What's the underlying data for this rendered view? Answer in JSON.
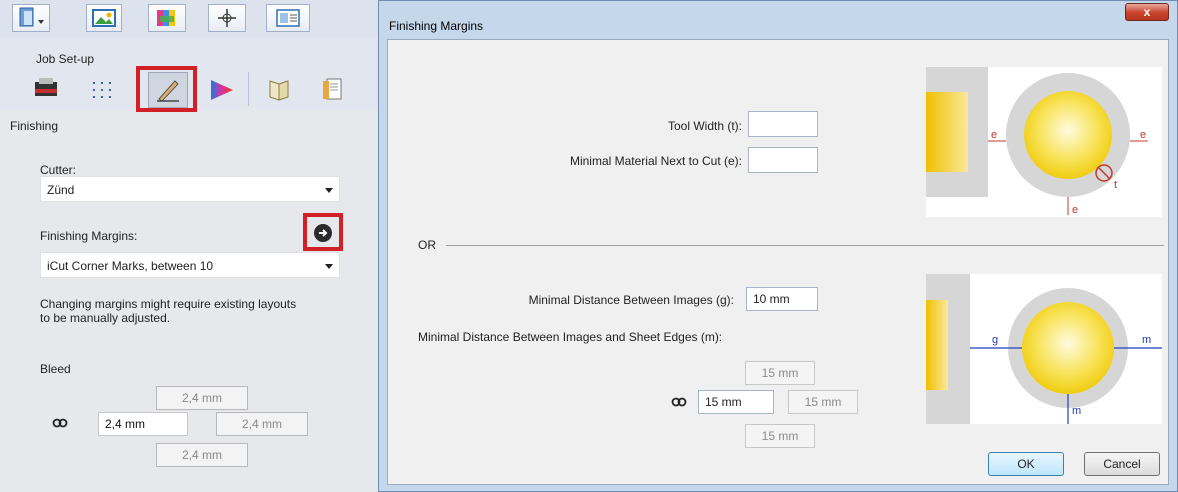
{
  "left_panel": {
    "section_title": "Job Set-up",
    "finishing_heading": "Finishing",
    "cutter_label": "Cutter:",
    "cutter_value": "Zünd",
    "finishing_margins_label": "Finishing Margins:",
    "finishing_margins_value": "iCut Corner Marks, between 10",
    "warning_text_line1": "Changing margins might require existing layouts",
    "warning_text_line2": "to be manually adjusted.",
    "bleed_label": "Bleed",
    "bleed_top": "2,4 mm",
    "bleed_left": "2,4 mm",
    "bleed_right": "2,4 mm",
    "bleed_bottom": "2,4 mm"
  },
  "dialog": {
    "title": "Finishing Margins",
    "close_label": "x",
    "tool_width_label": "Tool Width (t):",
    "tool_width_value": "",
    "min_material_label": "Minimal Material Next to Cut (e):",
    "min_material_value": "",
    "or_label": "OR",
    "min_distance_images_label": "Minimal Distance Between Images (g):",
    "min_distance_images_value": "10 mm",
    "min_distance_edges_label": "Minimal Distance Between Images and Sheet Edges (m):",
    "edge_top": "15 mm",
    "edge_left": "15 mm",
    "edge_right": "15 mm",
    "edge_bottom": "15 mm",
    "ok_label": "OK",
    "cancel_label": "Cancel",
    "diagram1": {
      "e_left": "e",
      "e_right": "e",
      "t": "t",
      "e_bottom": "e"
    },
    "diagram2": {
      "g": "g",
      "m_right": "m",
      "m_bottom": "m"
    }
  },
  "colors": {
    "accent_red": "#d31f26",
    "circle_yellow": "#f5d81a",
    "margin_red": "#c0392b",
    "margin_blue": "#1f3fbf"
  }
}
